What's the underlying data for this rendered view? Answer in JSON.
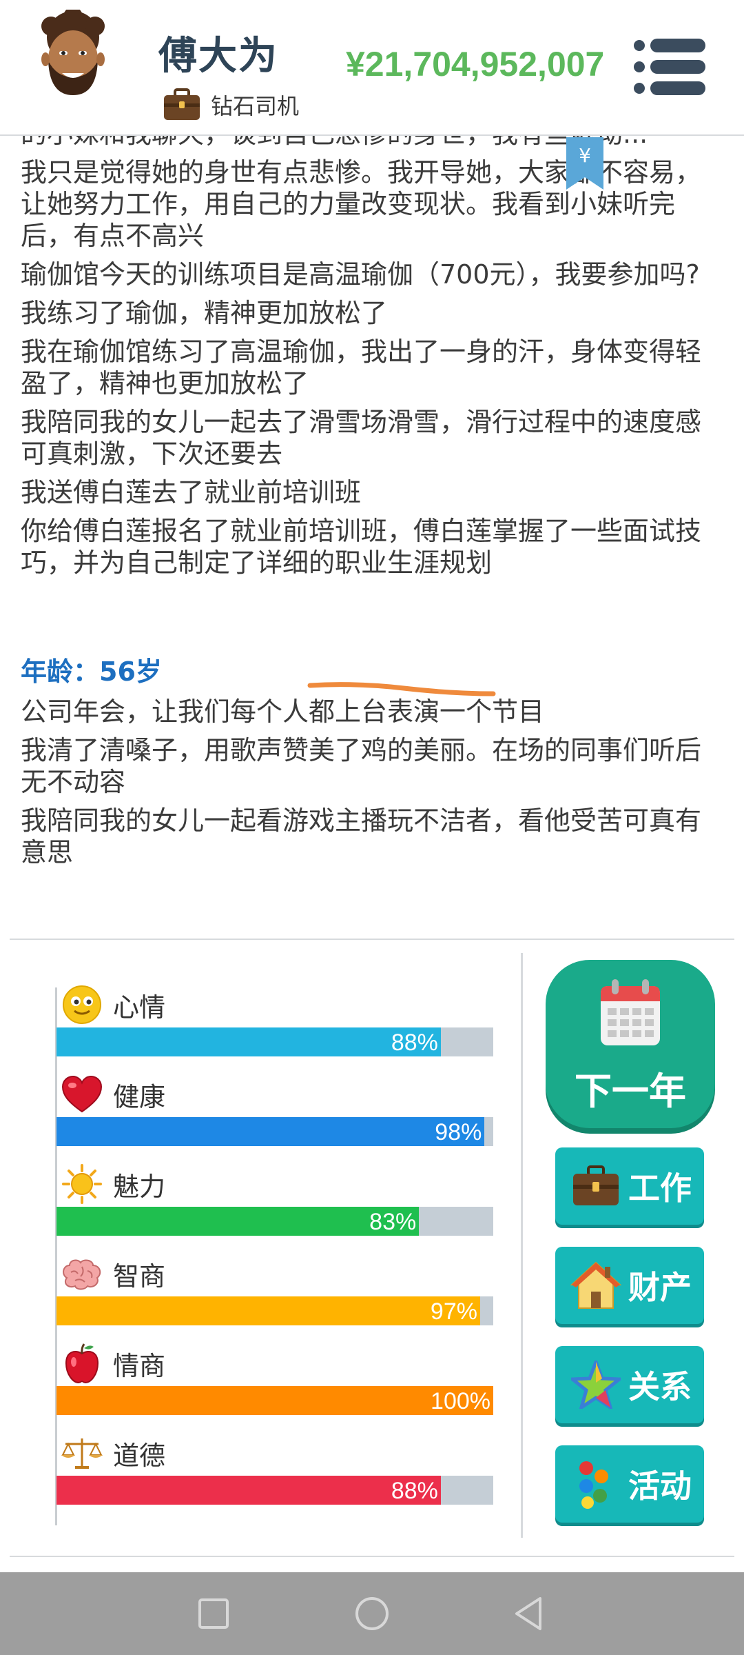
{
  "header": {
    "player_name": "傅大为",
    "job_title": "钻石司机",
    "money": "¥21,704,952,007",
    "icons": {
      "avatar": "avatar-face",
      "job": "briefcase-icon",
      "menu": "hamburger-menu-icon"
    }
  },
  "log": {
    "yen_tag": "¥",
    "entries": [
      "的小妹和我聊天，谈到自己悲惨的身世，我有些触动...",
      "我只是觉得她的身世有点悲惨。我开导她，大家都不容易，让她努力工作，用自己的力量改变现状。我看到小妹听完后，有点不高兴",
      "瑜伽馆今天的训练项目是高温瑜伽（700元），我要参加吗?",
      "我练习了瑜伽，精神更加放松了",
      "我在瑜伽馆练习了高温瑜伽，我出了一身的汗，身体变得轻盈了，精神也更加放松了",
      "我陪同我的女儿一起去了滑雪场滑雪，滑行过程中的速度感可真刺激，下次还要去",
      "我送傅白莲去了就业前培训班",
      "你给傅白莲报名了就业前培训班，傅白莲掌握了一些面试技巧，并为自己制定了详细的职业生涯规划"
    ],
    "age_label": "年龄：56岁",
    "entries_after_age": [
      "公司年会，让我们每个人都上台表演一个节目",
      "我清了清嗓子，用歌声赞美了鸡的美丽。在场的同事们听后无不动容",
      "我陪同我的女儿一起看游戏主播玩不洁者，看他受苦可真有意思"
    ]
  },
  "stats": [
    {
      "label": "心情",
      "value_text": "88%",
      "value": 88,
      "color": "#22b4e0",
      "icon": "smiley-icon"
    },
    {
      "label": "健康",
      "value_text": "98%",
      "value": 98,
      "color": "#1e88e5",
      "icon": "heart-icon"
    },
    {
      "label": "魅力",
      "value_text": "83%",
      "value": 83,
      "color": "#1fbf4f",
      "icon": "sun-icon"
    },
    {
      "label": "智商",
      "value_text": "97%",
      "value": 97,
      "color": "#ffb300",
      "icon": "brain-icon"
    },
    {
      "label": "情商",
      "value_text": "100%",
      "value": 100,
      "color": "#ff8a00",
      "icon": "apple-icon"
    },
    {
      "label": "道德",
      "value_text": "88%",
      "value": 88,
      "color": "#ec2f4b",
      "icon": "scales-icon"
    }
  ],
  "actions": {
    "next_year": "下一年",
    "work": "工作",
    "property": "财产",
    "relations": "关系",
    "activities": "活动"
  },
  "colors": {
    "money": "#5cb85c",
    "age": "#1d6fc0",
    "button_teal": "#17b8b8",
    "next_year_green": "#1aaa8a"
  }
}
